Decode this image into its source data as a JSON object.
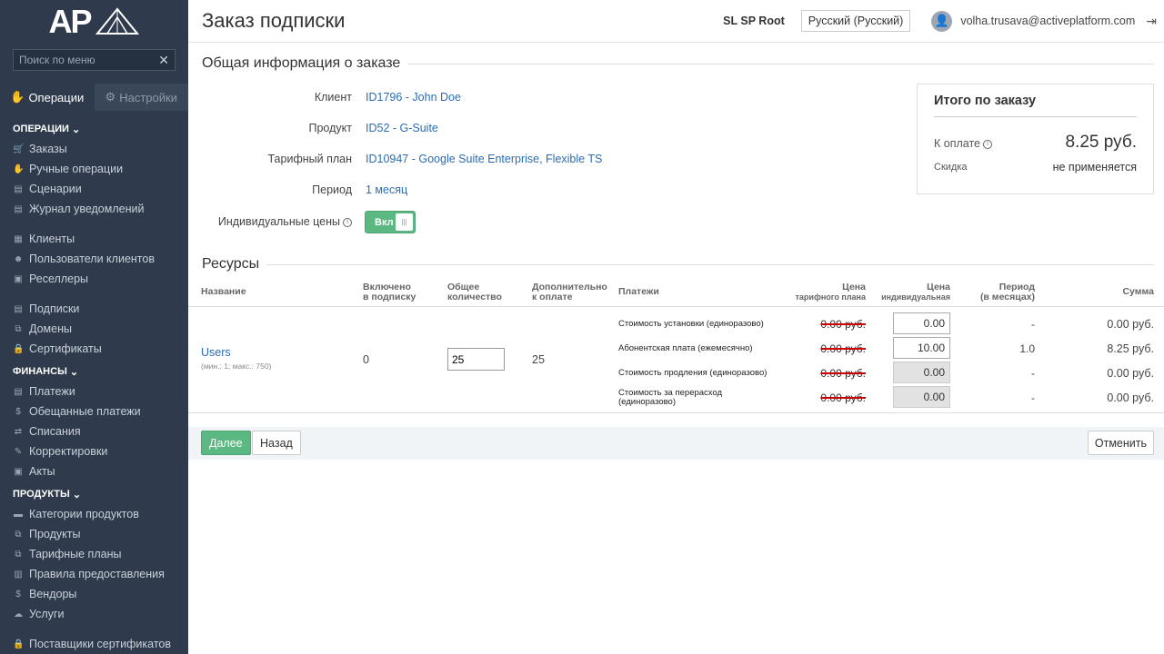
{
  "sidebar": {
    "logo_text": "AP",
    "search_placeholder": "Поиск по меню",
    "tabs": [
      {
        "label": "Операции"
      },
      {
        "label": "Настройки"
      }
    ],
    "sections": {
      "operations": "ОПЕРАЦИИ",
      "finance": "ФИНАНСЫ",
      "products": "ПРОДУКТЫ"
    },
    "items": {
      "orders": "Заказы",
      "manual_ops": "Ручные операции",
      "scenarios": "Сценарии",
      "notif_log": "Журнал уведомлений",
      "clients": "Клиенты",
      "client_users": "Пользователи клиентов",
      "resellers": "Реселлеры",
      "subscriptions": "Подписки",
      "domains": "Домены",
      "certificates": "Сертификаты",
      "payments": "Платежи",
      "promised_payments": "Обещанные платежи",
      "writeoffs": "Списания",
      "adjustments": "Корректировки",
      "acts": "Акты",
      "product_categories": "Категории продуктов",
      "products": "Продукты",
      "tariff_plans": "Тарифные планы",
      "provision_rules": "Правила предоставления",
      "vendors": "Вендоры",
      "services": "Услуги",
      "cert_providers": "Поставщики сертификатов"
    }
  },
  "header": {
    "title": "Заказ подписки",
    "account": "SL SP Root",
    "language": "Русский (Русский)",
    "email": "volha.trusava@activeplatform.com"
  },
  "general": {
    "section_title": "Общая информация о заказе",
    "client_label": "Клиент",
    "client_value": "ID1796 - John Doe",
    "product_label": "Продукт",
    "product_value": "ID52 - G-Suite",
    "plan_label": "Тарифный план",
    "plan_value": "ID10947 - Google Suite Enterprise, Flexible TS",
    "period_label": "Период",
    "period_value": "1 месяц",
    "individual_label": "Индивидуальные цены",
    "toggle_label": "Вкл"
  },
  "summary": {
    "title": "Итого по заказу",
    "pay_label": "К оплате",
    "pay_value": "8.25 руб.",
    "discount_label": "Скидка",
    "discount_value": "не применяется"
  },
  "resources": {
    "section_title": "Ресурсы",
    "headers": {
      "name": "Название",
      "included_1": "Включено",
      "included_2": "в подписку",
      "total_1": "Общее",
      "total_2": "количество",
      "extra_1": "Дополнительно",
      "extra_2": "к оплате",
      "payments": "Платежи",
      "plan_price_1": "Цена",
      "plan_price_2": "тарифного плана",
      "ind_price_1": "Цена",
      "ind_price_2": "индивидуальная",
      "period_1": "Период",
      "period_2": "(в месяцах)",
      "sum": "Сумма"
    },
    "row": {
      "name": "Users",
      "limits": "(мин.: 1; макс.: 750)",
      "included": "0",
      "quantity": "25",
      "extra": "25",
      "payments": [
        {
          "label": "Стоимость установки (единоразово)",
          "plan_price": "0.00 руб.",
          "ind_price": "0.00",
          "period": "-",
          "sum": "0.00 руб."
        },
        {
          "label": "Абонентская плата (ежемесячно)",
          "plan_price": "0.00 руб.",
          "ind_price": "10.00",
          "period": "1.0",
          "sum": "8.25 руб."
        },
        {
          "label": "Стоимость продления (единоразово)",
          "plan_price": "0.00 руб.",
          "ind_price": "0.00",
          "period": "-",
          "sum": "0.00 руб."
        },
        {
          "label_1": "Стоимость за перерасход",
          "label_2": "(единоразово)",
          "plan_price": "0.00 руб.",
          "ind_price": "0.00",
          "period": "-",
          "sum": "0.00 руб."
        }
      ]
    }
  },
  "footer": {
    "next": "Далее",
    "back": "Назад",
    "cancel": "Отменить"
  }
}
